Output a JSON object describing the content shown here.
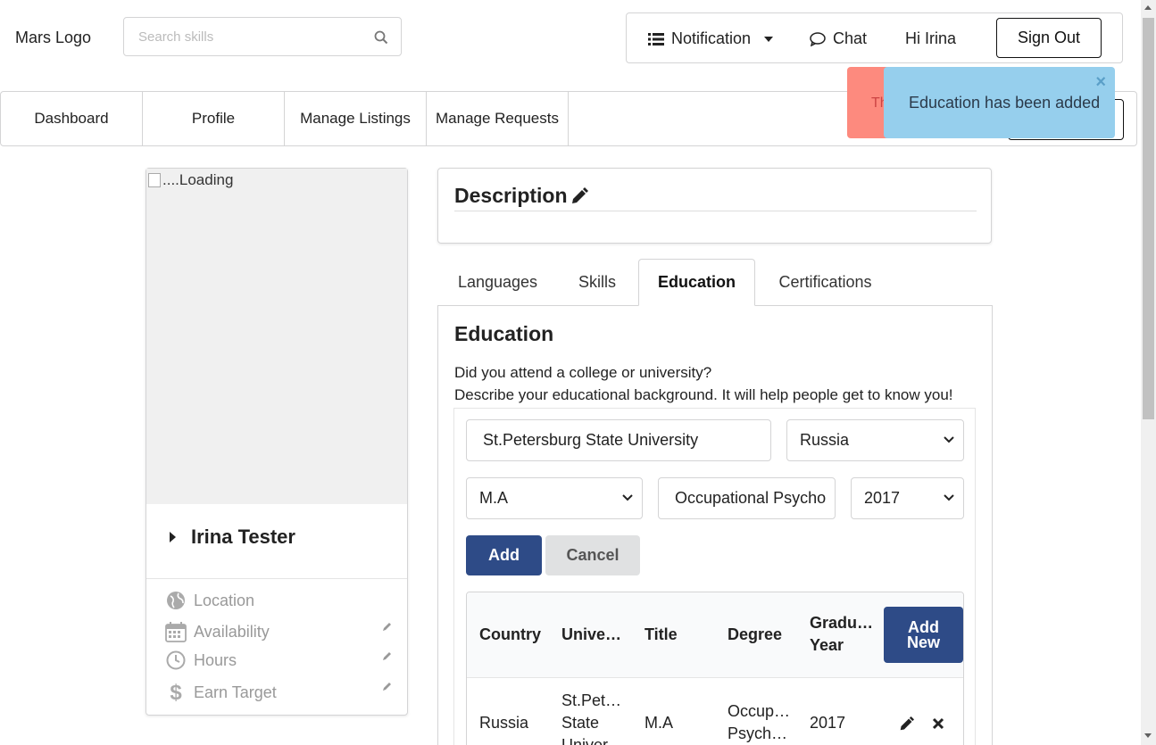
{
  "header": {
    "logo": "Mars Logo",
    "search_placeholder": "Search skills",
    "notification": "Notification",
    "chat": "Chat",
    "greeting": "Hi Irina",
    "signout": "Sign Out"
  },
  "nav": {
    "items": [
      "Dashboard",
      "Profile",
      "Manage Listings",
      "Manage Requests"
    ]
  },
  "toasts": {
    "error_text": "Th",
    "info_text": "Education has been added",
    "close": "×"
  },
  "profile": {
    "image_alt": "....Loading",
    "name": "Irina Tester",
    "location": "Location",
    "availability": "Availability",
    "hours": "Hours",
    "earn_target": "Earn Target"
  },
  "description": {
    "title": "Description"
  },
  "tabs": [
    "Languages",
    "Skills",
    "Education",
    "Certifications"
  ],
  "education": {
    "title": "Education",
    "line1": "Did you attend a college or university?",
    "line2": "Describe your educational background. It will help people get to know you!",
    "university_value": "St.Petersburg State University",
    "country_value": "Russia",
    "title_value": "M.A",
    "degree_value": "Occupational Psycho",
    "year_value": "2017",
    "add": "Add",
    "cancel": "Cancel",
    "add_new_line1": "Add",
    "add_new_line2": "New"
  },
  "table": {
    "headers": {
      "country": "Country",
      "university": "Unive…",
      "title": "Title",
      "degree": "Degree",
      "grad_line1": "Gradu…",
      "grad_line2": "Year"
    },
    "rows": [
      {
        "country": "Russia",
        "university_l1": "St.Pet…",
        "university_l2": "State",
        "university_l3": "Univer…",
        "title": "M.A",
        "degree_l1": "Occup…",
        "degree_l2": "Psych…",
        "year": "2017"
      }
    ]
  }
}
